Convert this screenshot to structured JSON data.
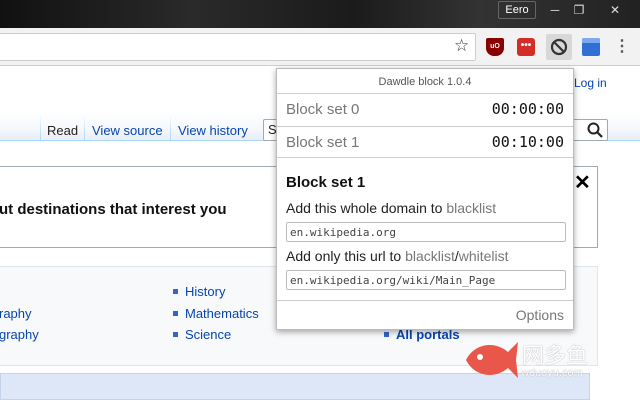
{
  "window": {
    "profile_name": "Eero"
  },
  "toolbar": {
    "extensions": [
      "ublock-origin-icon",
      "lastpass-icon",
      "dawdle-block-icon",
      "blue-extension-icon"
    ],
    "ublock_text": "uO",
    "lastpass_text": "•••"
  },
  "page": {
    "login_link": "Log in",
    "tabs": {
      "read": "Read",
      "view_source": "View source",
      "view_history": "View history"
    },
    "search_value": "Se",
    "banner_text": "ut destinations that interest you",
    "portal_links": [
      "History",
      "raphy",
      "Mathematics",
      "graphy",
      "Science",
      "All portals"
    ]
  },
  "popup": {
    "title": "Dawdle block 1.0.4",
    "block_sets": [
      {
        "name": "Block set 0",
        "time": "00:00:00"
      },
      {
        "name": "Block set 1",
        "time": "00:10:00"
      }
    ],
    "detail": {
      "heading": "Block set 1",
      "domain_prefix": "Add this whole domain to",
      "domain_link": "blacklist",
      "domain_value": "en.wikipedia.org",
      "url_prefix": "Add only this url to",
      "url_link_black": "blacklist",
      "url_sep": "/",
      "url_link_white": "whitelist",
      "url_value": "en.wikipedia.org/wiki/Main_Page"
    },
    "options_label": "Options"
  },
  "watermark": {
    "text": "网多鱼",
    "sub": "wduoyu.com"
  },
  "colors": {
    "link": "#0645ad",
    "popup_muted": "#777777",
    "accent_red": "#e8574a"
  }
}
